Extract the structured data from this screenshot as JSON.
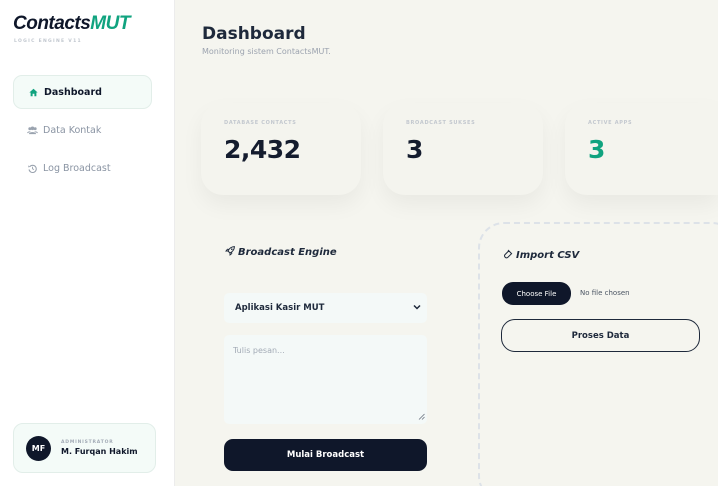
{
  "brand": {
    "name_primary": "Contacts",
    "name_accent": "MUT",
    "tagline": "LOGIC ENGINE V11"
  },
  "nav": {
    "items": [
      {
        "label": "Dashboard",
        "icon": "home-icon",
        "active": true
      },
      {
        "label": "Data Kontak",
        "icon": "users-icon",
        "active": false
      },
      {
        "label": "Log Broadcast",
        "icon": "history-icon",
        "active": false
      }
    ]
  },
  "user": {
    "initials": "MF",
    "role": "ADMINISTRATOR",
    "name": "M. Furqan Hakim"
  },
  "header": {
    "title": "Dashboard",
    "subtitle": "Monitoring sistem ContactsMUT."
  },
  "stats": [
    {
      "label": "DATABASE CONTACTS",
      "value": "2,432"
    },
    {
      "label": "BROADCAST SUKSES",
      "value": "3"
    },
    {
      "label": "ACTIVE APPS",
      "value": "3"
    }
  ],
  "broadcast": {
    "title": "Broadcast Engine",
    "icon": "rocket-icon",
    "app_select_value": "Aplikasi Kasir MUT",
    "message_placeholder": "Tulis pesan...",
    "start_label": "Mulai Broadcast"
  },
  "import_csv": {
    "title": "Import CSV",
    "icon": "upload-file-icon",
    "choose_label": "Choose File",
    "file_status": "No file chosen",
    "process_label": "Proses Data"
  },
  "colors": {
    "accent": "#10a37f",
    "dark": "#0f172a",
    "background": "#f5f5ef"
  }
}
